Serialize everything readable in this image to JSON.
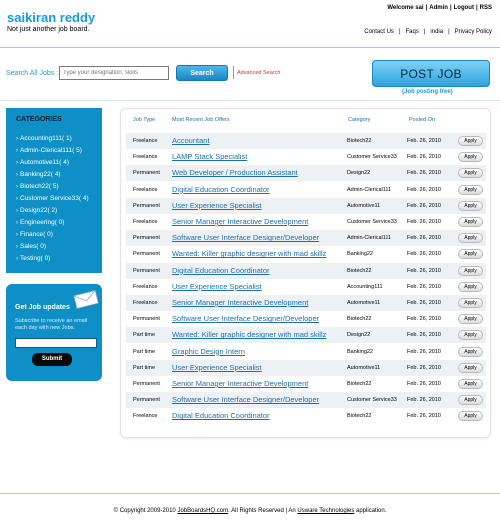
{
  "header": {
    "site_title": "saikiran reddy",
    "tagline": "Not just another job board.",
    "welcome": "Welcome sai",
    "top_links": [
      "Admin",
      "Logout",
      "RSS"
    ],
    "nav": [
      "Contact Us",
      "Faqs",
      "india",
      "Privacy Policy"
    ]
  },
  "search": {
    "label": "Search All Jobs :",
    "placeholder": "Type your designation, skills",
    "button": "Search",
    "advanced": "Advanced Search"
  },
  "post_job": {
    "button": "POST JOB",
    "sub": "(Job posting free)"
  },
  "categories": {
    "title": "CATEGORIES",
    "items": [
      "Accounting111( 1)",
      "Admin-Clerical111( 5)",
      "Automotive11( 4)",
      "Banking22( 4)",
      "Biotech22( 5)",
      "Customer Service33( 4)",
      "Design22( 2)",
      "Engineering( 0)",
      "Finance( 0)",
      "Sales( 0)",
      "Testing( 0)"
    ]
  },
  "job_updates": {
    "title": "Get Job updates",
    "text": "Subscribe to receive an email each day with new Jobs.",
    "button": "Submit",
    "icon": "envelope-icon"
  },
  "table": {
    "headers": {
      "type": "Job Type",
      "title": "Most Recent Job Offers",
      "category": "Category",
      "posted": "Posted On"
    },
    "apply_label": "Apply",
    "rows": [
      {
        "type": "Freelance",
        "title": "Accountant",
        "category": "Biotech22",
        "date": "Feb. 26, 2010"
      },
      {
        "type": "Freelance",
        "title": "LAMP Stack Specialist",
        "category": "Customer Service33",
        "date": "Feb. 26, 2010"
      },
      {
        "type": "Permanent",
        "title": "Web Developer / Production Assistant",
        "category": "Design22",
        "date": "Feb. 26, 2010"
      },
      {
        "type": "Freelance",
        "title": "Digital Education Coordinator",
        "category": "Admin-Clerical111",
        "date": "Feb. 26, 2010"
      },
      {
        "type": "Permanent",
        "title": "User Experience Specialist",
        "category": "Automotive11",
        "date": "Feb. 26, 2010"
      },
      {
        "type": "Freelance",
        "title": "Senior Manager Interactive Development",
        "category": "Customer Service33",
        "date": "Feb. 26, 2010"
      },
      {
        "type": "Permanent",
        "title": "Software User Interface Designer/Developer",
        "category": "Admin-Clerical111",
        "date": "Feb. 26, 2010"
      },
      {
        "type": "Permanent",
        "title": "Wanted: Killer graphic designer with mad skillz",
        "category": "Banking22",
        "date": "Feb. 26, 2010"
      },
      {
        "type": "Permanent",
        "title": "Digital Education Coordinator",
        "category": "Biotech22",
        "date": "Feb. 26, 2010"
      },
      {
        "type": "Freelance",
        "title": "User Experience Specialist",
        "category": "Accounting111",
        "date": "Feb. 26, 2010"
      },
      {
        "type": "Freelance",
        "title": "Senior Manager Interactive Development",
        "category": "Automotive11",
        "date": "Feb. 26, 2010"
      },
      {
        "type": "Permanent",
        "title": "Software User Interface Designer/Developer",
        "category": "Biotech22",
        "date": "Feb. 26, 2010"
      },
      {
        "type": "Part time",
        "title": "Wanted: Killer graphic designer with mad skillz",
        "category": "Design22",
        "date": "Feb. 26, 2010"
      },
      {
        "type": "Part time",
        "title": "Graphic Design Intern",
        "category": "Banking22",
        "date": "Feb. 26, 2010"
      },
      {
        "type": "Part time",
        "title": "User Experience Specialist",
        "category": "Automotive11",
        "date": "Feb. 26, 2010"
      },
      {
        "type": "Permanent",
        "title": "Senior Manager Interactive Development",
        "category": "Biotech22",
        "date": "Feb. 26, 2010"
      },
      {
        "type": "Permanent",
        "title": "Software User Interface Designer/Developer",
        "category": "Customer Service33",
        "date": "Feb. 26, 2010"
      },
      {
        "type": "Freelance",
        "title": "Digital Education Coordinator",
        "category": "Biotech22",
        "date": "Feb. 26, 2010"
      }
    ]
  },
  "footer": {
    "pre": "© Copyright 2009-2010",
    "link1": "JobBoardsHQ.com",
    "mid": ". All Rights Reserved | An",
    "link2": "Usware Technologies",
    "post": "application."
  }
}
